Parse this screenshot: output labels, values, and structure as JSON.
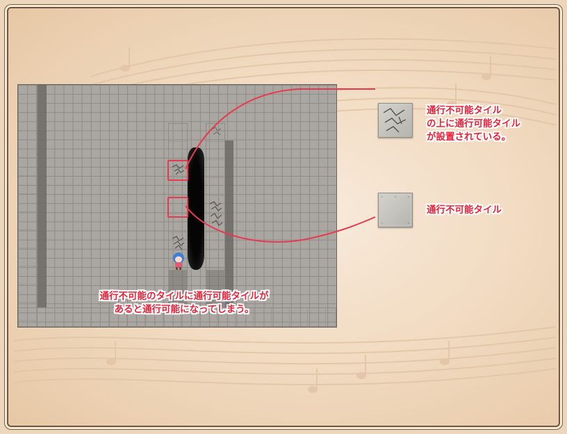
{
  "annotations": {
    "overlay_tile": {
      "lines": [
        "通行不可能タイル",
        "の上に通行可能タイル",
        "が設置されている。"
      ]
    },
    "impassable_tile": {
      "label": "通行不可能タイル"
    },
    "bottom_note": {
      "lines": [
        "通行不可能のタイルに通行可能タイルが",
        "あると通行可能になってしまう。"
      ]
    }
  },
  "colors": {
    "accent": "#e63b4e",
    "annotation_text": "#e8233a",
    "parchment": "#f2dcc3",
    "frame_border": "#6f553d"
  },
  "icons": [
    "cracked-tile-icon",
    "plain-tile-icon",
    "character-sprite-icon"
  ]
}
